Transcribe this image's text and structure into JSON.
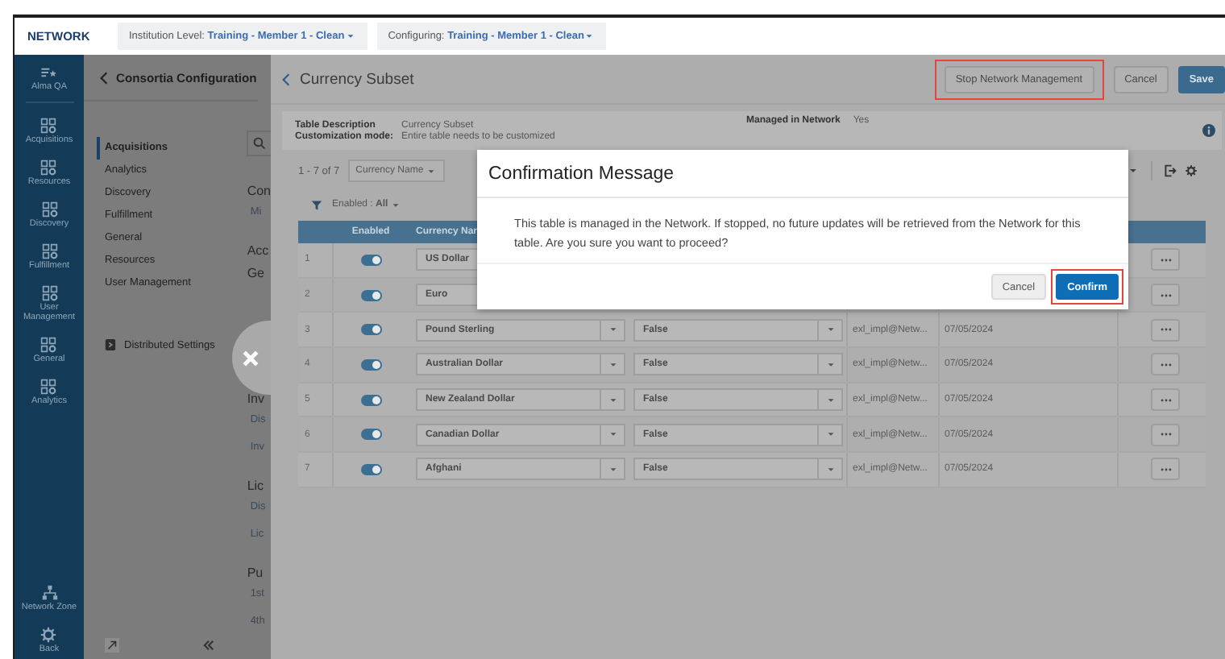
{
  "header": {
    "brand": "NETWORK",
    "scopes": [
      {
        "label": "Institution Level:",
        "value": "Training - Member 1 - Clean"
      },
      {
        "label": "Configuring:",
        "value": "Training - Member 1 - Clean"
      }
    ]
  },
  "nav": {
    "profile": "Alma QA",
    "items": [
      {
        "label": "Acquisitions"
      },
      {
        "label": "Resources"
      },
      {
        "label": "Discovery"
      },
      {
        "label": "Fulfillment"
      },
      {
        "label": "User Management"
      },
      {
        "label": "General"
      },
      {
        "label": "Analytics"
      }
    ],
    "bottom": [
      {
        "label": "Network Zone"
      },
      {
        "label": "Back"
      }
    ]
  },
  "config_panel": {
    "title": "Consortia Configuration",
    "menu": [
      {
        "label": "Acquisitions",
        "selected": true
      },
      {
        "label": "Analytics",
        "selected": false
      },
      {
        "label": "Discovery",
        "selected": false
      },
      {
        "label": "Fulfillment",
        "selected": false
      },
      {
        "label": "General",
        "selected": false
      },
      {
        "label": "Resources",
        "selected": false
      },
      {
        "label": "User Management",
        "selected": false
      }
    ],
    "distributed": "Distributed Settings",
    "column_fragments": [
      {
        "text": "Con",
        "kind": "heading"
      },
      {
        "text": "Mi",
        "kind": "link"
      },
      {
        "text": "Acc",
        "kind": "heading"
      },
      {
        "text": "Ge",
        "kind": "sub"
      },
      {
        "text": "Inv",
        "kind": "heading"
      },
      {
        "text": "Dis",
        "kind": "link"
      },
      {
        "text": "Inv",
        "kind": "link"
      },
      {
        "text": "Lic",
        "kind": "heading"
      },
      {
        "text": "Dis",
        "kind": "link"
      },
      {
        "text": "Lic",
        "kind": "link"
      },
      {
        "text": "Pu",
        "kind": "heading"
      },
      {
        "text": "1st",
        "kind": "link"
      },
      {
        "text": "4th",
        "kind": "link"
      }
    ]
  },
  "subset": {
    "title": "Currency Subset",
    "buttons": [
      {
        "label": "Stop Network Management",
        "kind": "secondary",
        "highlighted": true
      },
      {
        "label": "Cancel",
        "kind": "secondary",
        "highlighted": false
      },
      {
        "label": "Save",
        "kind": "primary",
        "highlighted": false
      }
    ],
    "info": [
      {
        "label": "Table Description",
        "value": "Currency Subset"
      },
      {
        "label": "Customization mode:",
        "value": "Entire table needs to be customized"
      }
    ],
    "managed": {
      "label": "Managed in Network",
      "value": "Yes"
    },
    "count": "1 - 7 of 7",
    "sort": "Currency Name",
    "filter": "Enabled : **All**",
    "columns": [
      "Enabled",
      "Currency Nar"
    ],
    "rows": [
      {
        "index": "1",
        "enabled": true,
        "currency": "US Dollar"
      },
      {
        "index": "2",
        "enabled": true,
        "currency": "Euro"
      },
      {
        "index": "3",
        "enabled": true,
        "currency": "Pound Sterling",
        "flag": "False",
        "user": "exl_impl@Netw...",
        "date": "07/05/2024"
      },
      {
        "index": "4",
        "enabled": true,
        "currency": "Australian Dollar",
        "flag": "False",
        "user": "exl_impl@Netw...",
        "date": "07/05/2024"
      },
      {
        "index": "5",
        "enabled": true,
        "currency": "New Zealand Dollar",
        "flag": "False",
        "user": "exl_impl@Netw...",
        "date": "07/05/2024"
      },
      {
        "index": "6",
        "enabled": true,
        "currency": "Canadian Dollar",
        "flag": "False",
        "user": "exl_impl@Netw...",
        "date": "07/05/2024"
      },
      {
        "index": "7",
        "enabled": true,
        "currency": "Afghani",
        "flag": "False",
        "user": "exl_impl@Netw...",
        "date": "07/05/2024"
      }
    ]
  },
  "dialog": {
    "title": "Confirmation Message",
    "message": "This table is managed in the Network. If stopped, no future updates will be retrieved from the Network for this table. Are you sure you want to proceed?",
    "buttons": [
      {
        "label": "Cancel",
        "kind": "secondary",
        "highlighted": false
      },
      {
        "label": "Confirm",
        "kind": "primary",
        "highlighted": true
      }
    ]
  }
}
